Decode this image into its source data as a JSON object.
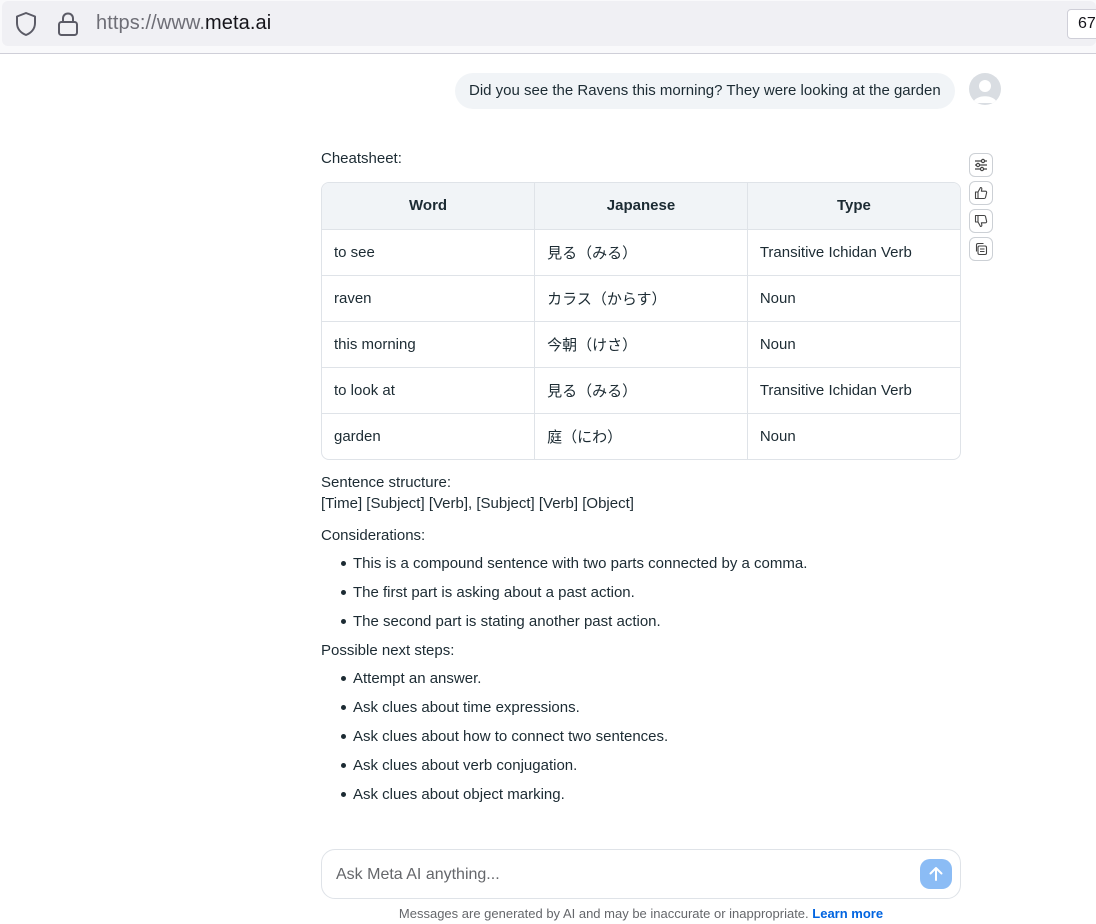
{
  "browser": {
    "url_prefix": "https://www.",
    "url_domain": "meta.ai",
    "zoom_label": "67",
    "icons": {
      "shield": "shield-icon",
      "lock": "lock-icon"
    }
  },
  "chat": {
    "user_message": "Did you see the Ravens this morning? They were looking at the garden",
    "response": {
      "cheatsheet_label": "Cheatsheet:",
      "table": {
        "headers": [
          "Word",
          "Japanese",
          "Type"
        ],
        "rows": [
          [
            "to see",
            "見る（みる）",
            "Transitive Ichidan Verb"
          ],
          [
            "raven",
            "カラス（からす）",
            "Noun"
          ],
          [
            "this morning",
            "今朝（けさ）",
            "Noun"
          ],
          [
            "to look at",
            "見る（みる）",
            "Transitive Ichidan Verb"
          ],
          [
            "garden",
            "庭（にわ）",
            "Noun"
          ]
        ]
      },
      "structure_label": "Sentence structure:",
      "structure_value": "[Time] [Subject] [Verb], [Subject] [Verb] [Object]",
      "considerations_label": "Considerations:",
      "considerations": [
        "This is a compound sentence with two parts connected by a comma.",
        "The first part is asking about a past action.",
        "The second part is stating another past action."
      ],
      "next_steps_label": "Possible next steps:",
      "next_steps": [
        "Attempt an answer.",
        "Ask clues about time expressions.",
        "Ask clues about how to connect two sentences.",
        "Ask clues about verb conjugation.",
        "Ask clues about object marking."
      ]
    },
    "reaction_icons": [
      "sliders-icon",
      "thumbs-up-icon",
      "thumbs-down-icon",
      "copy-icon"
    ]
  },
  "composer": {
    "placeholder": "Ask Meta AI anything...",
    "value": "",
    "send_icon": "arrow-up-icon"
  },
  "footer": {
    "disclaimer": "Messages are generated by AI and may be inaccurate or inappropriate.",
    "learn_more": "Learn more"
  },
  "colors": {
    "accent": "#0064e0",
    "send_button": "#8bbcf5",
    "bubble_bg": "#f1f4f7"
  }
}
